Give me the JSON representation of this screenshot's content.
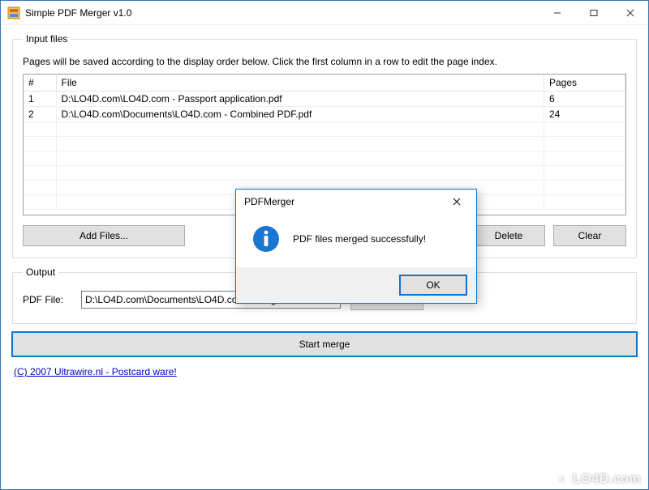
{
  "window": {
    "title": "Simple PDF Merger v1.0"
  },
  "input": {
    "legend": "Input files",
    "hint": "Pages will be saved according to the display order below. Click the first column in a row to edit the page index.",
    "columns": {
      "idx": "#",
      "file": "File",
      "pages": "Pages"
    },
    "rows": [
      {
        "idx": "1",
        "file": "D:\\LO4D.com\\LO4D.com - Passport application.pdf",
        "pages": "6"
      },
      {
        "idx": "2",
        "file": "D:\\LO4D.com\\Documents\\LO4D.com - Combined PDF.pdf",
        "pages": "24"
      }
    ],
    "buttons": {
      "add": "Add Files...",
      "delete": "Delete",
      "clear": "Clear"
    }
  },
  "output": {
    "legend": "Output",
    "label": "PDF File:",
    "path": "D:\\LO4D.com\\Documents\\LO4D.com - Merged.PDF",
    "browse": "Browse..."
  },
  "start": "Start merge",
  "footer_link": "(C) 2007 Ultrawire.nl - Postcard ware!",
  "dialog": {
    "title": "PDFMerger",
    "message": "PDF files merged successfully!",
    "ok": "OK"
  },
  "watermark": "LO4D.com"
}
